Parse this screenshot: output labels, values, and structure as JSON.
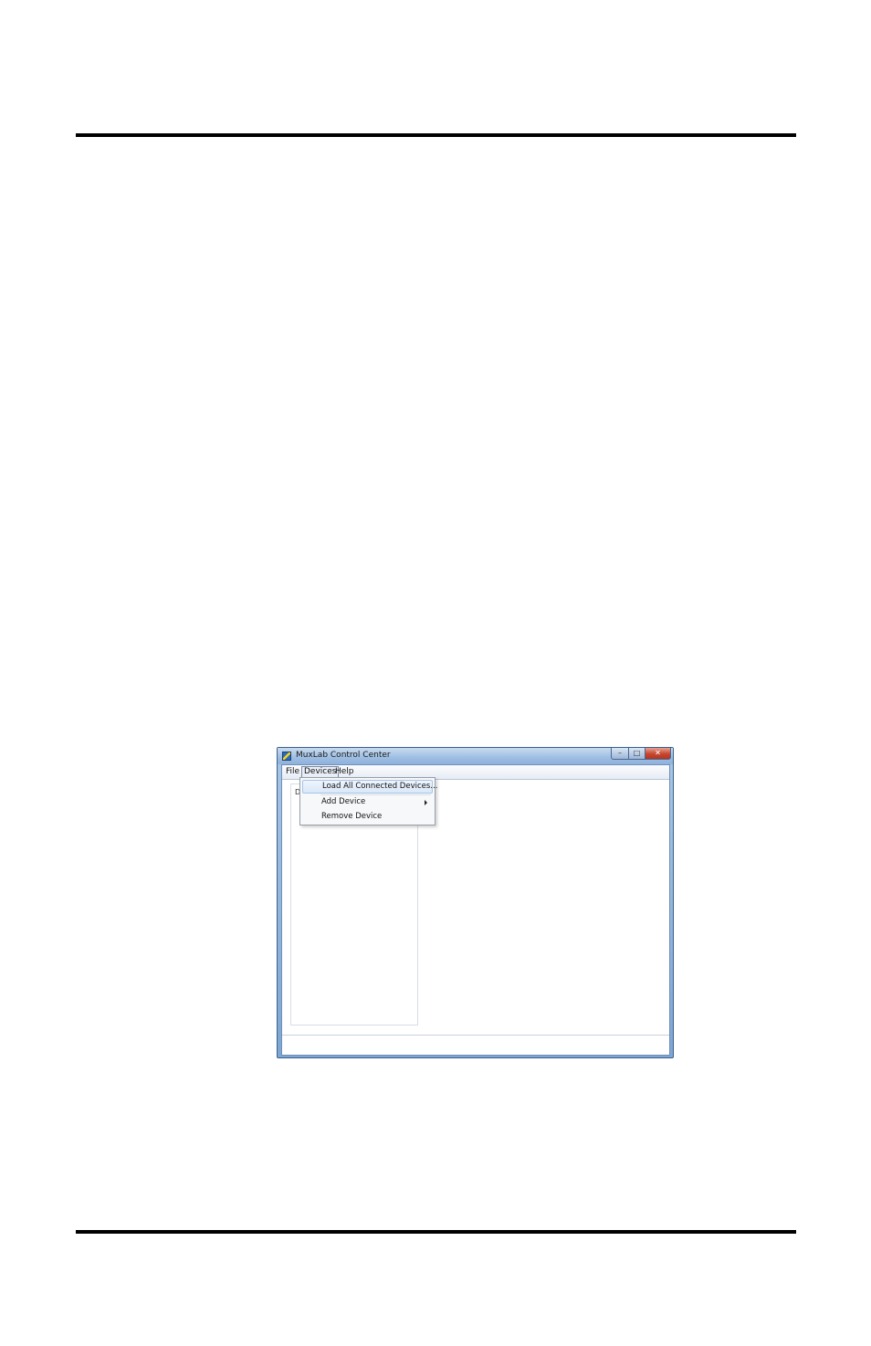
{
  "window": {
    "title": "MuxLab Control Center",
    "controls": {
      "minimize": "–",
      "maximize": "□",
      "close": "✕"
    }
  },
  "menubar": {
    "items": [
      {
        "label": "File"
      },
      {
        "label": "Devices"
      },
      {
        "label": "Help"
      }
    ]
  },
  "devices_menu": {
    "items": [
      {
        "label": "Load All Connected Devices..."
      },
      {
        "label": "Add Device"
      },
      {
        "label": "Remove Device"
      }
    ]
  },
  "left_panel": {
    "label": "De"
  },
  "colors": {
    "titlebar": "#9dbde2",
    "close_button": "#c6472f",
    "menu_highlight": "#d9e8f9"
  }
}
